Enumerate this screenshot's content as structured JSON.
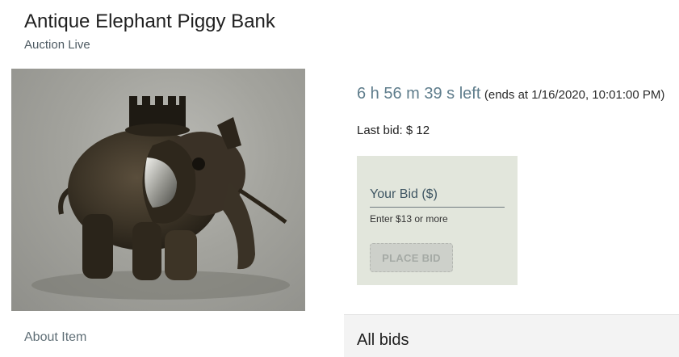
{
  "header": {
    "title": "Antique Elephant Piggy Bank",
    "status": "Auction Live"
  },
  "item": {
    "image_icon": "elephant-piggy-bank-photo",
    "about_label": "About Item"
  },
  "auction": {
    "time_left": "6 h 56 m 39 s left",
    "ends_at": "(ends at 1/16/2020, 10:01:00 PM)",
    "last_bid": "Last bid: $ 12"
  },
  "bid_form": {
    "field_label": "Your Bid ($)",
    "helper_text": "Enter $13 or more",
    "button_label": "PLACE BID"
  },
  "bids": {
    "title": "All bids"
  },
  "colors": {
    "countdown": "#5f7d8c",
    "bid_panel_bg": "#e2e6dc",
    "button_disabled_bg": "#cdd0ca",
    "button_disabled_text": "#a5aaa5"
  }
}
